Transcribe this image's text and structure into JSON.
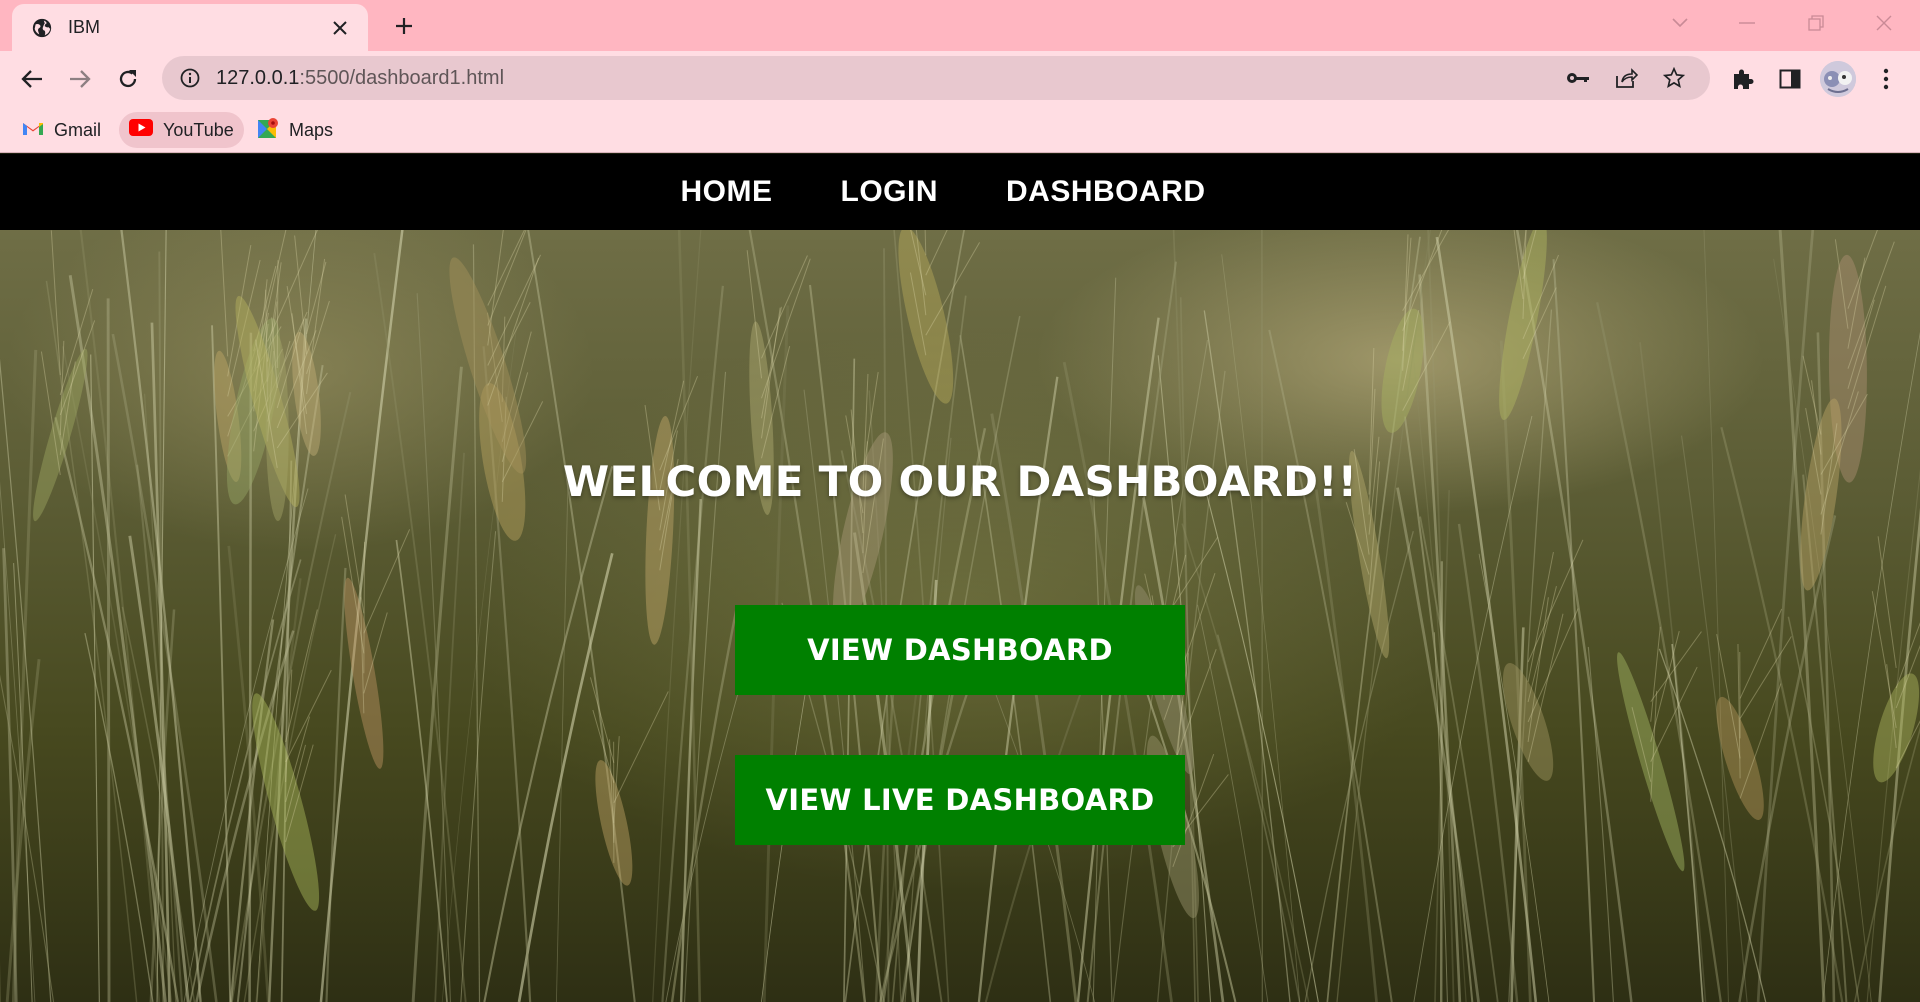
{
  "browser": {
    "tab": {
      "title": "IBM",
      "icon": "globe-icon"
    },
    "address": {
      "url_host": "127.0.0.1",
      "url_rest": ":5500/dashboard1.html"
    },
    "bookmarks": [
      {
        "label": "Gmail",
        "icon": "gmail-icon"
      },
      {
        "label": "YouTube",
        "icon": "youtube-icon"
      },
      {
        "label": "Maps",
        "icon": "maps-icon"
      }
    ]
  },
  "nav": {
    "home": "HOME",
    "login": "LOGIN",
    "dashboard": "DASHBOARD"
  },
  "hero": {
    "title": "WELCOME TO OUR DASHBOARD!!",
    "button_view": "VIEW DASHBOARD",
    "button_live": "VIEW LIVE DASHBOARD",
    "button_color": "#008000"
  },
  "colors": {
    "tabstrip": "#ffb6c1",
    "toolbar": "#ffdde3",
    "navbar": "#000000"
  }
}
